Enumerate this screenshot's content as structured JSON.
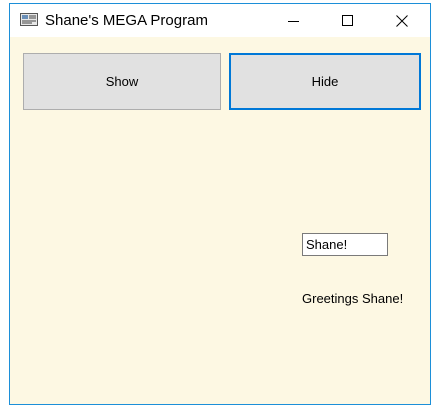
{
  "window": {
    "title": "Shane's MEGA Program",
    "app_icon": "window-app-icon",
    "controls": {
      "minimize_icon": "minimize-icon",
      "maximize_icon": "maximize-icon",
      "close_icon": "close-icon"
    }
  },
  "buttons": {
    "show_label": "Show",
    "hide_label": "Hide"
  },
  "name_input": {
    "value": "Shane!"
  },
  "greeting": {
    "text": "Greetings Shane!"
  },
  "colors": {
    "form_background": "#fdf8e3",
    "window_border": "#1c8fd8",
    "button_face": "#e1e1e1",
    "focus_border": "#0078d7"
  }
}
